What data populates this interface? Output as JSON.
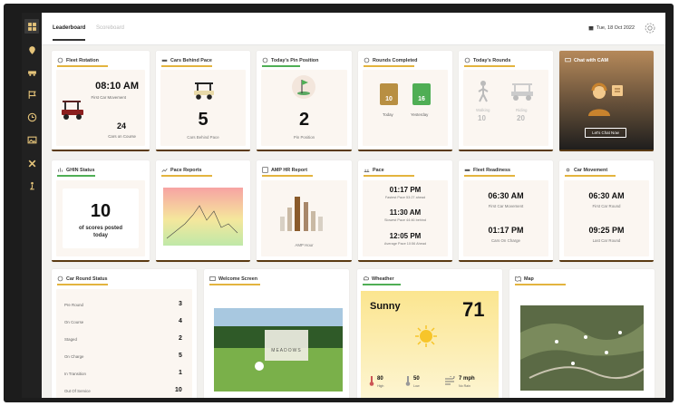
{
  "nav": {
    "items": [
      "grid-icon",
      "pin-icon",
      "cart-icon",
      "flag-icon",
      "clock-icon",
      "image-icon",
      "tools-icon",
      "golfer-icon"
    ]
  },
  "header": {
    "tab_active": "Leaderboard",
    "tab_inactive": "Scoreboard",
    "date": "Tue, 18 Oct 2022"
  },
  "cards": {
    "fleet_rotation": {
      "title": "Fleet Rotation",
      "time": "08:10 AM",
      "caption": "First Car Movement",
      "count": "24",
      "count_label": "Cars on Course"
    },
    "cars_behind": {
      "title": "Cars Behind Pace",
      "value": "5",
      "label": "Cars Behind Pace"
    },
    "pin_position": {
      "title": "Today's Pin Position",
      "value": "2",
      "label": "Pin Position"
    },
    "rounds_completed": {
      "title": "Rounds Completed",
      "today_val": "10",
      "yesterday_val": "16",
      "today_label": "Today",
      "yesterday_label": "Yesterday"
    },
    "todays_rounds": {
      "title": "Today's Rounds",
      "walking_label": "Walking",
      "walking_val": "10",
      "riding_label": "Riding",
      "riding_val": "20"
    },
    "chat": {
      "title": "Chat with CAM",
      "button": "Let's Chat Now"
    },
    "ghin": {
      "title": "GHIN Status",
      "value": "10",
      "label": "of scores posted today"
    },
    "pace_reports": {
      "title": "Pace Reports"
    },
    "amp_hr": {
      "title": "AMP HR Report",
      "label": "AMP Hour"
    },
    "pace": {
      "title": "Pace",
      "t1": "01:17 PM",
      "l1": "Fastest Pace 53:27 ahead",
      "t2": "11:30 AM",
      "l2": "Slowest Pace 44:46 behind",
      "t3": "12:05 PM",
      "l3": "Average Pace 10:56 Ahead"
    },
    "fleet_readiness": {
      "title": "Fleet Readiness",
      "t1": "06:30 AM",
      "l1": "First Car Movement",
      "t2": "01:17 PM",
      "l2": "Cars On Charge"
    },
    "car_movement": {
      "title": "Car Movement",
      "t1": "06:30 AM",
      "l1": "First Car Round",
      "t2": "09:25 PM",
      "l2": "Last Car Round"
    },
    "car_round_status": {
      "title": "Car Round Status",
      "rows": [
        {
          "label": "Pre Round",
          "value": "3"
        },
        {
          "label": "On Course",
          "value": "4"
        },
        {
          "label": "Staged",
          "value": "2"
        },
        {
          "label": "On Charge",
          "value": "5"
        },
        {
          "label": "In Transition",
          "value": "1"
        },
        {
          "label": "Out Of Service",
          "value": "10"
        }
      ]
    },
    "welcome": {
      "title": "Welcome Screen",
      "logo_text": "MEADOWS"
    },
    "weather": {
      "title": "Wheather",
      "condition": "Sunny",
      "temp": "71",
      "high": "80",
      "high_label": "High",
      "low": "50",
      "low_label": "Low",
      "wind": "7 mph",
      "wind_label": "No Rain"
    },
    "map": {
      "title": "Map"
    }
  }
}
